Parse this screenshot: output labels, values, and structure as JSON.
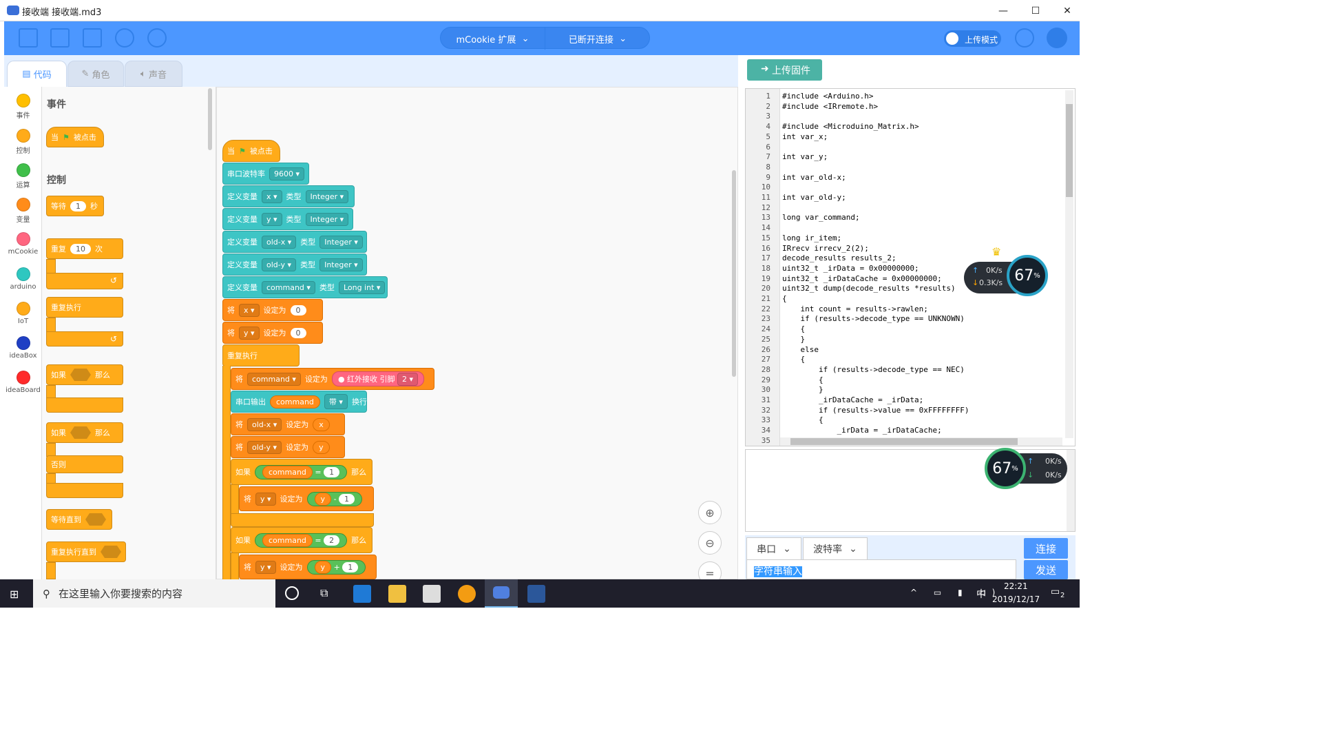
{
  "title": "接收端 接收端.md3",
  "toolbar": {
    "ext_menu": "mCookie 扩展",
    "conn_menu": "已断开连接",
    "upload_mode": "上传模式"
  },
  "tabs": [
    {
      "label": "代码"
    },
    {
      "label": "角色"
    },
    {
      "label": "声音"
    }
  ],
  "categories": [
    {
      "label": "事件",
      "color": "#ffbf00"
    },
    {
      "label": "控制",
      "color": "#ffab19"
    },
    {
      "label": "运算",
      "color": "#40bf4a"
    },
    {
      "label": "变量",
      "color": "#ff8c1a"
    },
    {
      "label": "mCookie",
      "color": "#ff6680"
    },
    {
      "label": "arduino",
      "color": "#2ec7c0"
    },
    {
      "label": "IoT",
      "color": "#ffab19"
    },
    {
      "label": "ideaBox",
      "color": "#1f3fc4"
    },
    {
      "label": "ideaBoard",
      "color": "#ff2a2a"
    }
  ],
  "flyout": {
    "events_title": "事件",
    "when_prefix": "当",
    "when_clicked": "被点击",
    "control_title": "控制",
    "wait": "等待",
    "wait_val": "1",
    "wait_unit": "秒",
    "repeat": "重复",
    "repeat_val": "10",
    "repeat_unit": "次",
    "forever": "重复执行",
    "if": "如果",
    "then": "那么",
    "else": "否则",
    "wait_until": "等待直到",
    "repeat_until": "重复执行直到"
  },
  "script": {
    "when": "当",
    "clicked": "被点击",
    "baud_label": "串口波特率",
    "baud_val": "9600",
    "define_var": "定义变量",
    "type": "类型",
    "vars": [
      {
        "name": "x",
        "type": "Integer"
      },
      {
        "name": "y",
        "type": "Integer"
      },
      {
        "name": "old-x",
        "type": "Integer"
      },
      {
        "name": "old-y",
        "type": "Integer"
      },
      {
        "name": "command",
        "type": "Long int"
      }
    ],
    "set": "将",
    "set_to": "设定为",
    "set_x_val": "0",
    "set_y_val": "0",
    "forever": "重复执行",
    "ir_recv": "红外接收 引脚",
    "ir_pin": "2",
    "serial_print": "串口输出",
    "with": "带",
    "newline": "换行",
    "if": "如果",
    "then": "那么",
    "cmp1": "1",
    "cmp2": "2",
    "minus": "-",
    "plus": "+",
    "one": "1",
    "var_x": "x",
    "var_y": "y",
    "var_oldx": "old-x",
    "var_oldy": "old-y",
    "var_cmd": "command"
  },
  "upload_firmware": "上传固件",
  "code_lines": [
    "#include <Arduino.h>",
    "#include <IRremote.h>",
    "",
    "#include <Microduino_Matrix.h>",
    "int var_x;",
    "",
    "int var_y;",
    "",
    "int var_old-x;",
    "",
    "int var_old-y;",
    "",
    "long var_command;",
    "",
    "long ir_item;",
    "IRrecv irrecv_2(2);",
    "decode_results results_2;",
    "uint32_t _irData = 0x00000000;",
    "uint32_t _irDataCache = 0x00000000;",
    "uint32_t dump(decode_results *results)",
    "{",
    "    int count = results->rawlen;",
    "    if (results->decode_type == UNKNOWN)",
    "    {",
    "    }",
    "    else",
    "    {",
    "        if (results->decode_type == NEC)",
    "        {",
    "        }",
    "        _irDataCache = _irData;",
    "        if (results->value == 0xFFFFFFFF)",
    "        {",
    "            _irData = _irDataCache;"
  ],
  "line_numbers": [
    "1",
    "2",
    "3",
    "4",
    "5",
    "6",
    "7",
    "8",
    "9",
    "10",
    "11",
    "12",
    "13",
    "14",
    "15",
    "16",
    "17",
    "18",
    "19",
    "20",
    "21",
    "22",
    "23",
    "24",
    "25",
    "26",
    "27",
    "28",
    "29",
    "30",
    "31",
    "32",
    "33",
    "34",
    "35"
  ],
  "net_widget_top": {
    "up": "0K/s",
    "down": "0.3K/s",
    "pct": "67",
    "unit": "%"
  },
  "net_widget_bottom": {
    "up": "0K/s",
    "down": "0K/s",
    "pct": "67",
    "unit": "%"
  },
  "serial": {
    "port": "串口",
    "baud": "波特率",
    "connect": "连接",
    "send": "发送",
    "input_value": "字符串输入"
  },
  "taskbar": {
    "search_placeholder": "在这里输入你要搜索的内容",
    "time": "22:21",
    "date": "2019/12/17",
    "ime": "中",
    "notif": "2"
  }
}
